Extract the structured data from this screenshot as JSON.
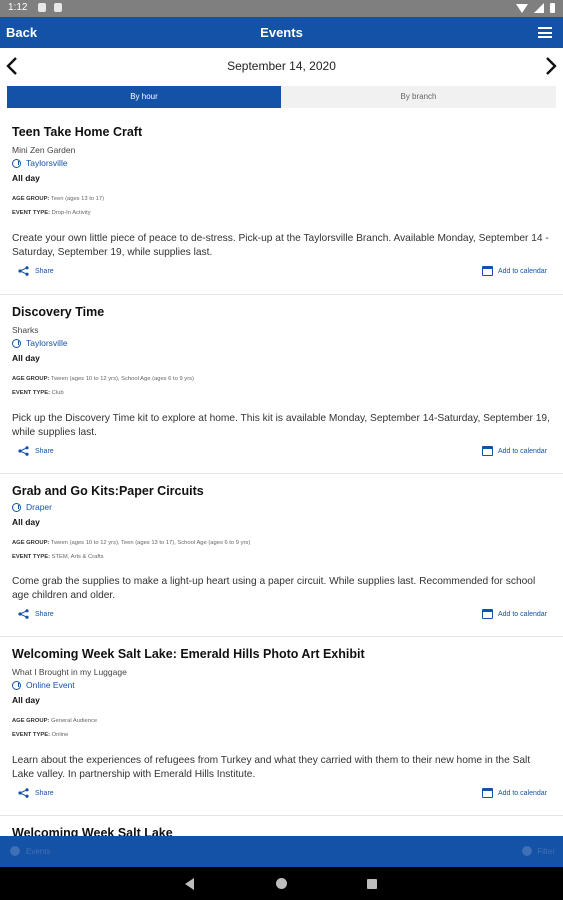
{
  "status_bar": {
    "time": "1:12"
  },
  "app_bar": {
    "back_label": "Back",
    "title": "Events"
  },
  "date_nav": {
    "date": "September 14, 2020"
  },
  "tabs": [
    {
      "label": "By hour",
      "active": true
    },
    {
      "label": "By branch",
      "active": false
    }
  ],
  "labels": {
    "age_group": "AGE GROUP:",
    "event_type": "EVENT TYPE:",
    "share": "Share",
    "add_to_calendar": "Add to calendar"
  },
  "events": [
    {
      "title": "Teen Take Home Craft",
      "subtitle": "Mini Zen Garden",
      "branch": "Taylorsville",
      "time": "All day",
      "age_group": "Teen (ages 13 to 17)",
      "event_type": "Drop-In Activity",
      "description": "Create your own little piece of peace to de-stress. Pick-up at the Taylorsville Branch. Available Monday, September 14 - Saturday, September 19, while supplies last."
    },
    {
      "title": "Discovery Time",
      "subtitle": "Sharks",
      "branch": "Taylorsville",
      "time": "All day",
      "age_group": "Tween (ages 10 to 12 yrs), School Age (ages 6 to 9 yrs)",
      "event_type": "Club",
      "description": "Pick up the Discovery Time kit to explore at home. This kit is available Monday, September 14-Saturday, September 19, while supplies last."
    },
    {
      "title": "Grab and Go Kits:Paper Circuits",
      "subtitle": "",
      "branch": "Draper",
      "time": "All day",
      "age_group": "Tween (ages 10 to 12 yrs), Teen (ages 13 to 17), School Age (ages 6 to 9 yrs)",
      "event_type": "STEM, Arts & Crafts",
      "description": "Come grab the supplies to make a light-up heart using a paper circuit. While supplies last. Recommended for school age children and older."
    },
    {
      "title": "Welcoming Week Salt Lake: Emerald Hills Photo Art Exhibit",
      "subtitle": "What I Brought in my Luggage",
      "branch": "Online Event",
      "time": "All day",
      "age_group": "General Audience",
      "event_type": "Online",
      "description": "Learn about the experiences of refugees from Turkey and what they carried with them to their new home in the Salt Lake valley. In partnership with Emerald Hills Institute."
    },
    {
      "title": "Welcoming Week Salt Lake"
    }
  ],
  "bottom_bar": {
    "left_label": "Events",
    "right_label": "Filter"
  },
  "colors": {
    "primary": "#1452a7",
    "status_bar": "#7f7f7f",
    "nav_bar": "#000000"
  }
}
